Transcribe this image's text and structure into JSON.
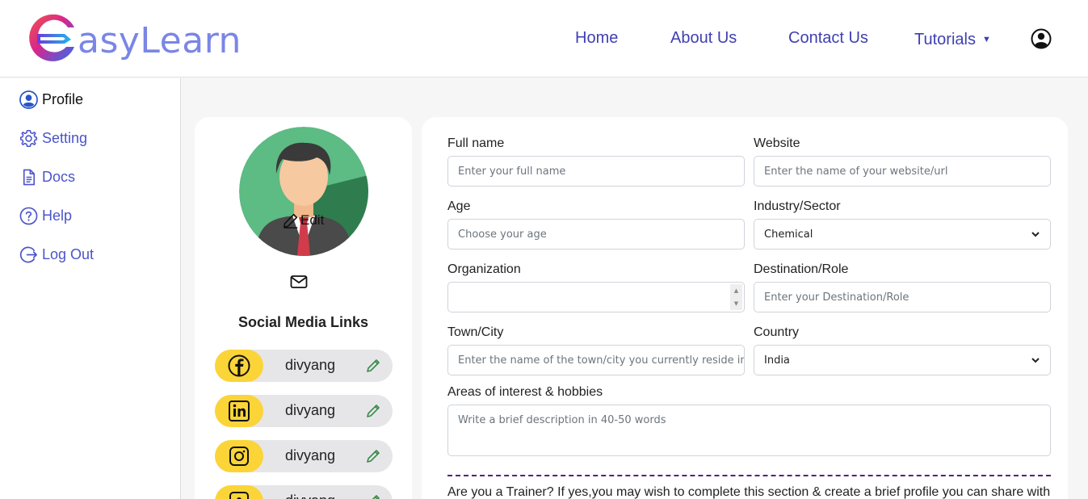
{
  "header": {
    "logo_text": "asyLearn",
    "nav": {
      "home": "Home",
      "about": "About Us",
      "contact": "Contact Us",
      "tutorials": "Tutorials"
    }
  },
  "sidebar": {
    "items": [
      {
        "label": "Profile",
        "icon": "profile-icon"
      },
      {
        "label": "Setting",
        "icon": "gear-icon"
      },
      {
        "label": "Docs",
        "icon": "document-icon"
      },
      {
        "label": "Help",
        "icon": "help-icon"
      },
      {
        "label": "Log Out",
        "icon": "logout-icon"
      }
    ]
  },
  "profile_card": {
    "edit_label": "Edit",
    "social_title": "Social Media Links",
    "socials": [
      {
        "network": "facebook-icon",
        "name": "divyang"
      },
      {
        "network": "linkedin-icon",
        "name": "divyang"
      },
      {
        "network": "instagram-icon",
        "name": "divyang"
      },
      {
        "network": "other-icon",
        "name": "divyang"
      }
    ]
  },
  "form": {
    "full_name": {
      "label": "Full name",
      "placeholder": "Enter your full name"
    },
    "website": {
      "label": "Website",
      "placeholder": "Enter the name of your website/url"
    },
    "age": {
      "label": "Age",
      "placeholder": "Choose your age"
    },
    "industry": {
      "label": "Industry/Sector",
      "value": "Chemical"
    },
    "organization": {
      "label": "Organization",
      "value": ""
    },
    "destination": {
      "label": "Destination/Role",
      "placeholder": "Enter your Destination/Role"
    },
    "town": {
      "label": "Town/City",
      "placeholder": "Enter the name of the town/city you currently reside in"
    },
    "country": {
      "label": "Country",
      "value": "India"
    },
    "interests": {
      "label": "Areas of interest & hobbies",
      "placeholder": "Write a brief description in 40-50 words"
    },
    "trainer_text": "Are you a Trainer? If yes,you may wish to complete this section & create a brief profile you can share with"
  },
  "colors": {
    "accent": "#4b54c9",
    "nav_text": "#3f3fb3",
    "badge": "#fbd437",
    "divider": "#5b1d78"
  }
}
